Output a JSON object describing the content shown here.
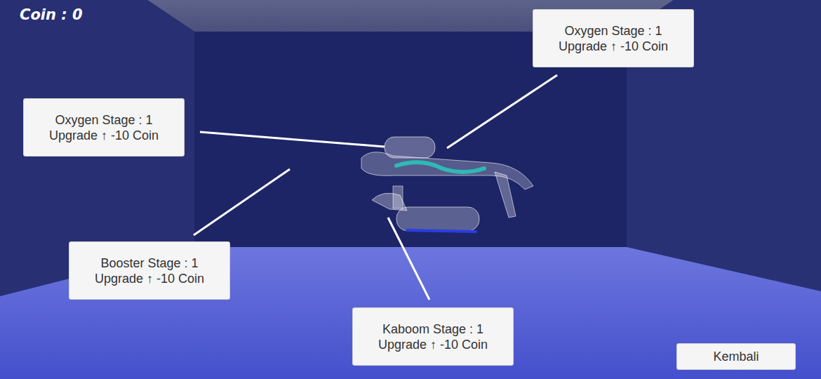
{
  "hud": {
    "coin": "Coin : 0"
  },
  "upgrades": [
    {
      "title": "Oxygen Stage : 1",
      "action": "Upgrade ↑ -10 Coin"
    },
    {
      "title": "Oxygen Stage : 1",
      "action": "Upgrade ↑ -10 Coin"
    },
    {
      "title": "Booster Stage : 1",
      "action": "Upgrade ↑ -10 Coin"
    },
    {
      "title": "Kaboom Stage : 1",
      "action": "Upgrade ↑ -10 Coin"
    }
  ],
  "buttons": [
    "Kembali"
  ]
}
